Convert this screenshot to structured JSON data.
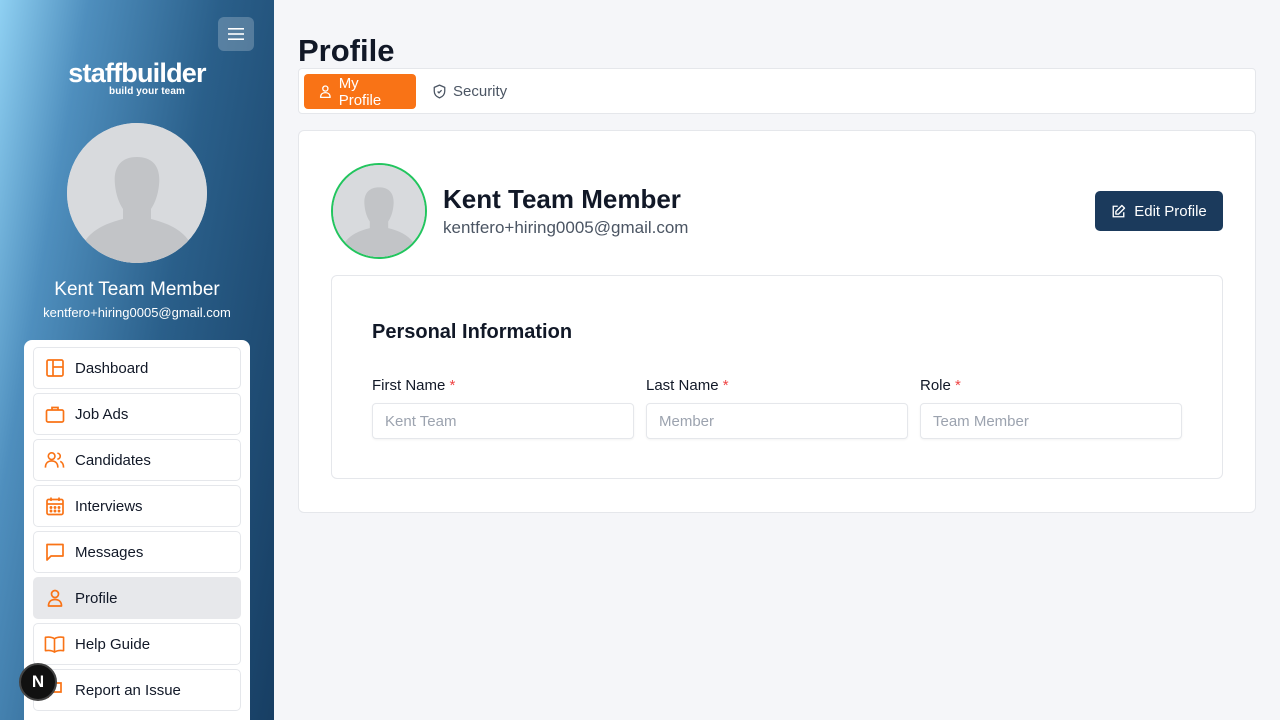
{
  "brand": {
    "name": "staffbuilder",
    "tagline": "build your team"
  },
  "user": {
    "name": "Kent Team Member",
    "email": "kentfero+hiring0005@gmail.com"
  },
  "sidebar": {
    "items": [
      {
        "label": "Dashboard",
        "icon": "layout-icon"
      },
      {
        "label": "Job Ads",
        "icon": "briefcase-icon"
      },
      {
        "label": "Candidates",
        "icon": "users-icon"
      },
      {
        "label": "Interviews",
        "icon": "calendar-icon"
      },
      {
        "label": "Messages",
        "icon": "message-icon"
      },
      {
        "label": "Profile",
        "icon": "user-icon",
        "active": true
      },
      {
        "label": "Help Guide",
        "icon": "book-icon"
      },
      {
        "label": "Report an Issue",
        "icon": "flag-icon"
      }
    ]
  },
  "page": {
    "title": "Profile"
  },
  "tabs": [
    {
      "label": "My Profile",
      "active": true
    },
    {
      "label": "Security",
      "active": false
    }
  ],
  "profile": {
    "edit_label": "Edit Profile"
  },
  "personal_info": {
    "title": "Personal Information",
    "fields": [
      {
        "label": "First Name",
        "required": "*",
        "placeholder": "Kent Team"
      },
      {
        "label": "Last Name",
        "required": "*",
        "placeholder": "Member"
      },
      {
        "label": "Role",
        "required": "*",
        "placeholder": "Team Member"
      }
    ]
  },
  "badge": {
    "label": "N"
  },
  "colors": {
    "accent": "#f97316",
    "primary": "#1b3a5c",
    "avatar_ring": "#22c55e",
    "required": "#ef4444"
  }
}
